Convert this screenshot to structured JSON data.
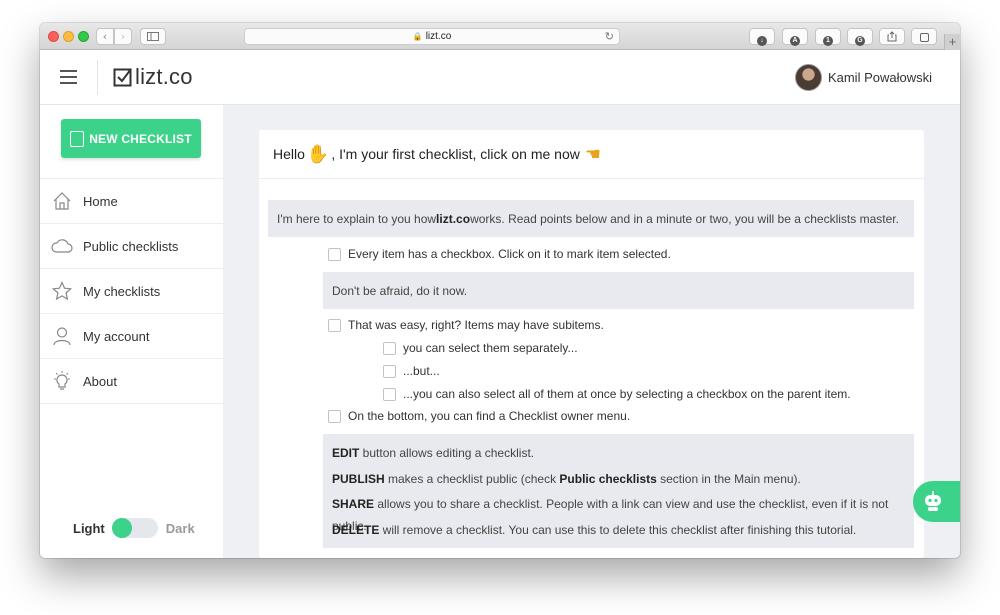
{
  "browser": {
    "url": "lizt.co"
  },
  "header": {
    "logo_text": "lizt.co",
    "user_name": "Kamil Powałowski"
  },
  "sidebar": {
    "new_button": "NEW CHECKLIST",
    "items": [
      {
        "label": "Home",
        "icon": "home-icon"
      },
      {
        "label": "Public checklists",
        "icon": "cloud-icon"
      },
      {
        "label": "My checklists",
        "icon": "star-icon"
      },
      {
        "label": "My account",
        "icon": "user-icon"
      },
      {
        "label": "About",
        "icon": "lightbulb-icon"
      }
    ],
    "theme": {
      "light_label": "Light",
      "dark_label": "Dark"
    }
  },
  "checklist": {
    "title_part1": "Hello",
    "title_part2": ", I'm your first checklist, click on me now",
    "intro_before": "I'm here to explain to you how ",
    "intro_bold": "lizt.co",
    "intro_after": " works. Read points below and in a minute or two, you will be a checklists master.",
    "items": [
      "Every item has a checkbox. Click on it to mark item selected.",
      "That was easy, right? Items may have subitems.",
      "On the bottom, you can find a Checklist owner menu."
    ],
    "note_1": "Don't be afraid, do it now.",
    "subitems": [
      "you can select them separately...",
      "...but...",
      "...you can also select all of them at once by selecting a checkbox on the parent item."
    ],
    "menu_help": [
      {
        "bold": "EDIT",
        "text": " button allows editing a checklist."
      },
      {
        "bold": "PUBLISH",
        "text": " makes a checklist public (check ",
        "bold2": "Public checklists",
        "text2": " section in the Main menu)."
      },
      {
        "bold": "SHARE",
        "text": " allows you to share a checklist. People with a link can view and use the checklist, even if it is not public."
      },
      {
        "bold": "DELETE",
        "text": " will remove a checklist. You can use this to delete this checklist after finishing this tutorial."
      }
    ]
  },
  "colors": {
    "accent": "#3dd28a",
    "panel": "#e8eaef",
    "background": "#eef0f4"
  }
}
